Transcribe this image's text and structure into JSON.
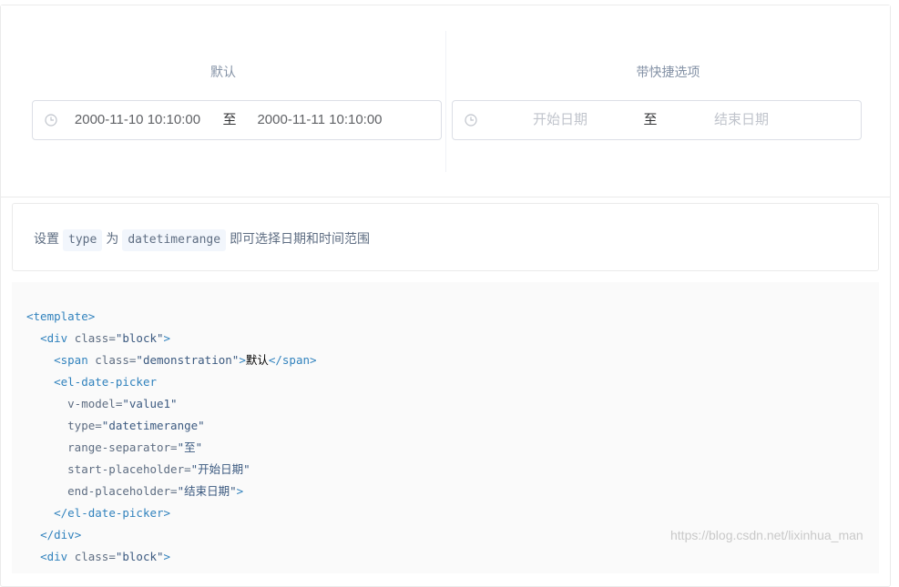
{
  "demo": {
    "left": {
      "title": "默认",
      "start_value": "2000-11-10 10:10:00",
      "separator": "至",
      "end_value": "2000-11-11 10:10:00"
    },
    "right": {
      "title": "带快捷选项",
      "start_placeholder": "开始日期",
      "separator": "至",
      "end_placeholder": "结束日期"
    }
  },
  "description": {
    "prefix": "设置",
    "code1": "type",
    "middle": "为",
    "code2": "datetimerange",
    "suffix": "即可选择日期和时间范围"
  },
  "code": {
    "l1_tag": "<template>",
    "l2_open": "<div ",
    "l2_attr": "class=",
    "l2_val": "\"block\"",
    "l2_close": ">",
    "l3_open": "<span ",
    "l3_attr": "class=",
    "l3_val": "\"demonstration\"",
    "l3_gt": ">",
    "l3_text": "默认",
    "l3_close": "</span>",
    "l4_tag": "<el-date-picker",
    "l5_attr": "v-model=",
    "l5_val": "\"value1\"",
    "l6_attr": "type=",
    "l6_val": "\"datetimerange\"",
    "l7_attr": "range-separator=",
    "l7_val": "\"至\"",
    "l8_attr": "start-placeholder=",
    "l8_val": "\"开始日期\"",
    "l9_attr": "end-placeholder=",
    "l9_val": "\"结束日期\"",
    "l9_gt": ">",
    "l10_tag": "</el-date-picker>",
    "l11_tag": "</div>",
    "l12_open": "<div ",
    "l12_attr": "class=",
    "l12_val": "\"block\"",
    "l12_close": ">"
  },
  "watermark": "https://blog.csdn.net/lixinhua_man",
  "colors": {
    "border": "#dcdfe6",
    "placeholder": "#c0c4cc",
    "text": "#606266",
    "code_tag": "#3182bd",
    "code_bg": "#fafafa"
  },
  "icons": {
    "picker_icon": "clock-icon"
  }
}
